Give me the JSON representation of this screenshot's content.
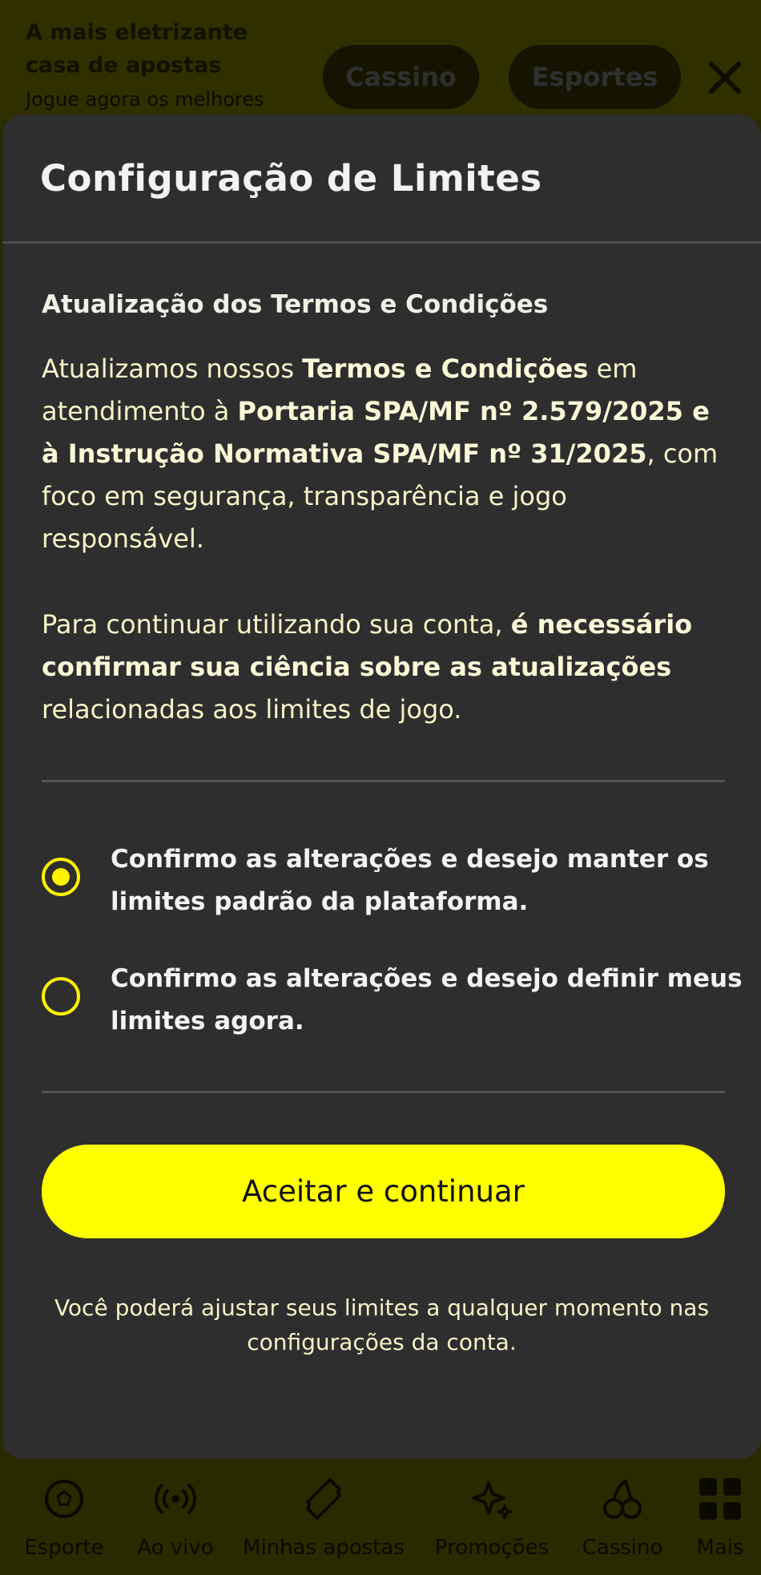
{
  "top": {
    "promo_title": "A mais eletrizante casa de apostas",
    "promo_subtitle": "Jogue agora os melhores",
    "cassino_label": "Cassino",
    "esportes_label": "Esportes",
    "close_icon": "close-icon"
  },
  "modal": {
    "title": "Configuração de Limites",
    "section_heading": "Atualização dos Termos e Condições",
    "para1": {
      "t1": "Atualizamos nossos ",
      "b1": "Termos e Condições",
      "t2": " em atendimento à ",
      "b2": "Portaria SPA/MF nº 2.579/2025 e à Instrução Normativa SPA/MF nº 31/2025",
      "t3": ", com foco em segurança, transparência e jogo responsável."
    },
    "para2": {
      "t1": "Para continuar utilizando sua conta, ",
      "b1": "é necessário confirmar sua ciência sobre as atualizações",
      "t2": " relacionadas aos limites de jogo."
    },
    "options": [
      {
        "label": "Confirmo as alterações e desejo manter os limites padrão da plataforma.",
        "selected": true
      },
      {
        "label": "Confirmo as alterações e desejo definir meus limites agora.",
        "selected": false
      }
    ],
    "accept_label": "Aceitar e continuar",
    "footnote": "Você poderá ajustar seus limites a qualquer momento nas configurações da conta."
  },
  "bottom_nav": [
    {
      "label": "Esporte",
      "icon": "soccer-ball-icon"
    },
    {
      "label": "Ao vivo",
      "icon": "live-broadcast-icon"
    },
    {
      "label": "Minhas apostas",
      "icon": "ticket-icon"
    },
    {
      "label": "Promoções",
      "icon": "sparkles-icon"
    },
    {
      "label": "Cassino",
      "icon": "cherries-icon"
    },
    {
      "label": "Mais",
      "icon": "grid-menu-icon"
    }
  ],
  "colors": {
    "accent": "#ffff00",
    "modal_bg": "#2e2e2e",
    "overlay_tint": "#2a2a00"
  }
}
